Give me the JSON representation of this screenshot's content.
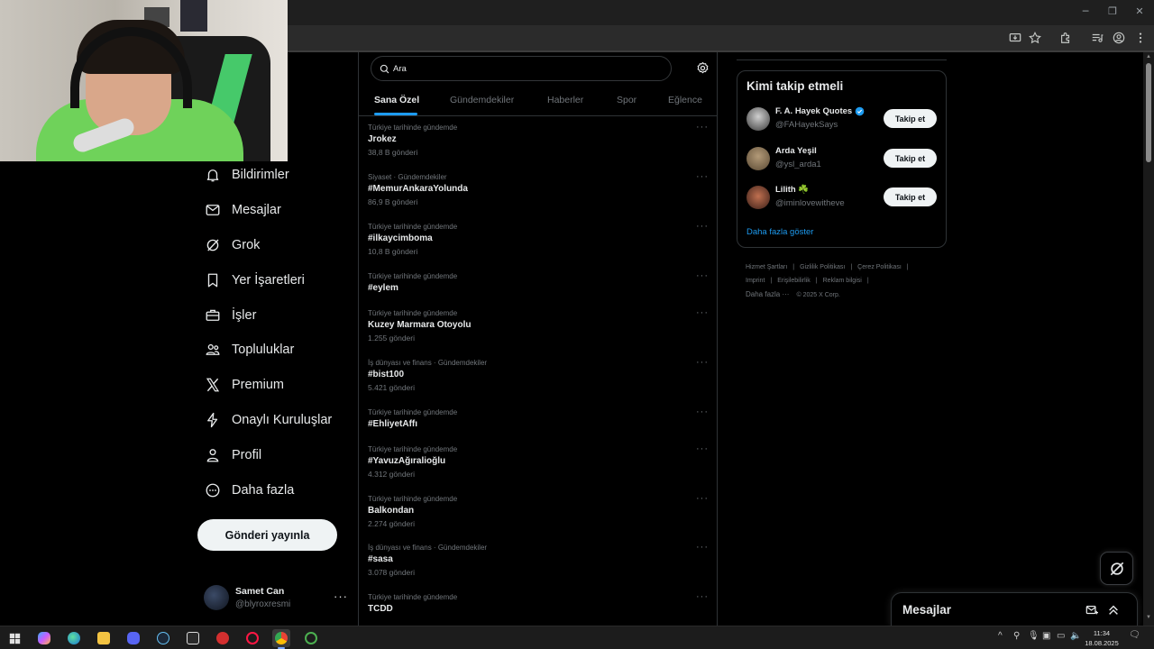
{
  "left_nav": {
    "items": [
      {
        "label": "Bildirimler",
        "icon": "bell-icon"
      },
      {
        "label": "Mesajlar",
        "icon": "envelope-icon"
      },
      {
        "label": "Grok",
        "icon": "grok-icon"
      },
      {
        "label": "Yer İşaretleri",
        "icon": "bookmark-icon"
      },
      {
        "label": "İşler",
        "icon": "briefcase-icon"
      },
      {
        "label": "Topluluklar",
        "icon": "people-icon"
      },
      {
        "label": "Premium",
        "icon": "x-logo-icon"
      },
      {
        "label": "Onaylı Kuruluşlar",
        "icon": "lightning-icon"
      },
      {
        "label": "Profil",
        "icon": "person-icon"
      },
      {
        "label": "Daha fazla",
        "icon": "more-circle-icon"
      }
    ],
    "post_button": "Gönderi yayınla",
    "profile": {
      "name": "Samet Can",
      "handle": "@blyroxresmi",
      "more": "···"
    }
  },
  "search": {
    "placeholder": "Ara"
  },
  "tabs": [
    "Sana Özel",
    "Gündemdekiler",
    "Haberler",
    "Spor",
    "Eğlence"
  ],
  "active_tab": "Sana Özel",
  "trends": [
    {
      "context": "Türkiye tarihinde gündemde",
      "name": "Jrokez",
      "count": "38,8 B gönderi"
    },
    {
      "context": "Siyaset · Gündemdekiler",
      "name": "#MemurAnkaraYolunda",
      "count": "86,9 B gönderi"
    },
    {
      "context": "Türkiye tarihinde gündemde",
      "name": "#ilkaycimboma",
      "count": "10,8 B gönderi"
    },
    {
      "context": "Türkiye tarihinde gündemde",
      "name": "#eylem",
      "count": ""
    },
    {
      "context": "Türkiye tarihinde gündemde",
      "name": "Kuzey Marmara Otoyolu",
      "count": "1.255 gönderi"
    },
    {
      "context": "İş dünyası ve finans · Gündemdekiler",
      "name": "#bist100",
      "count": "5.421 gönderi"
    },
    {
      "context": "Türkiye tarihinde gündemde",
      "name": "#EhliyetAffı",
      "count": ""
    },
    {
      "context": "Türkiye tarihinde gündemde",
      "name": "#YavuzAğıralioğlu",
      "count": "4.312 gönderi"
    },
    {
      "context": "Türkiye tarihinde gündemde",
      "name": "Balkondan",
      "count": "2.274 gönderi"
    },
    {
      "context": "İş dünyası ve finans · Gündemdekiler",
      "name": "#sasa",
      "count": "3.078 gönderi"
    },
    {
      "context": "Türkiye tarihinde gündemde",
      "name": "TCDD",
      "count": ""
    }
  ],
  "trend_more": "···",
  "who_to_follow": {
    "title": "Kimi takip etmeli",
    "users": [
      {
        "name": "F. A. Hayek Quotes",
        "handle": "@FAHayekSays",
        "verified": true,
        "button": "Takip et"
      },
      {
        "name": "Arda Yeşil",
        "handle": "@ysl_arda1",
        "verified": false,
        "button": "Takip et"
      },
      {
        "name": "Lilith ☘️",
        "handle": "@iminlovewitheve",
        "verified": false,
        "button": "Takip et"
      }
    ],
    "show_more": "Daha fazla göster"
  },
  "footer": {
    "links_row1": [
      "Hizmet Şartları",
      "Gizlilik Politikası",
      "Çerez Politikası"
    ],
    "links_row2": [
      "Imprint",
      "Erişilebilirlik",
      "Reklam bilgisi"
    ],
    "more": "Daha fazla ···",
    "copyright": "© 2025 X Corp."
  },
  "messages_drawer": {
    "title": "Mesajlar"
  },
  "taskbar": {
    "time": "11:34",
    "date": "18.08.2025"
  },
  "colors": {
    "accent": "#1d9bf0",
    "background": "#000000",
    "text": "#e7e9ea",
    "muted": "#71767b",
    "border": "#2f3336"
  }
}
